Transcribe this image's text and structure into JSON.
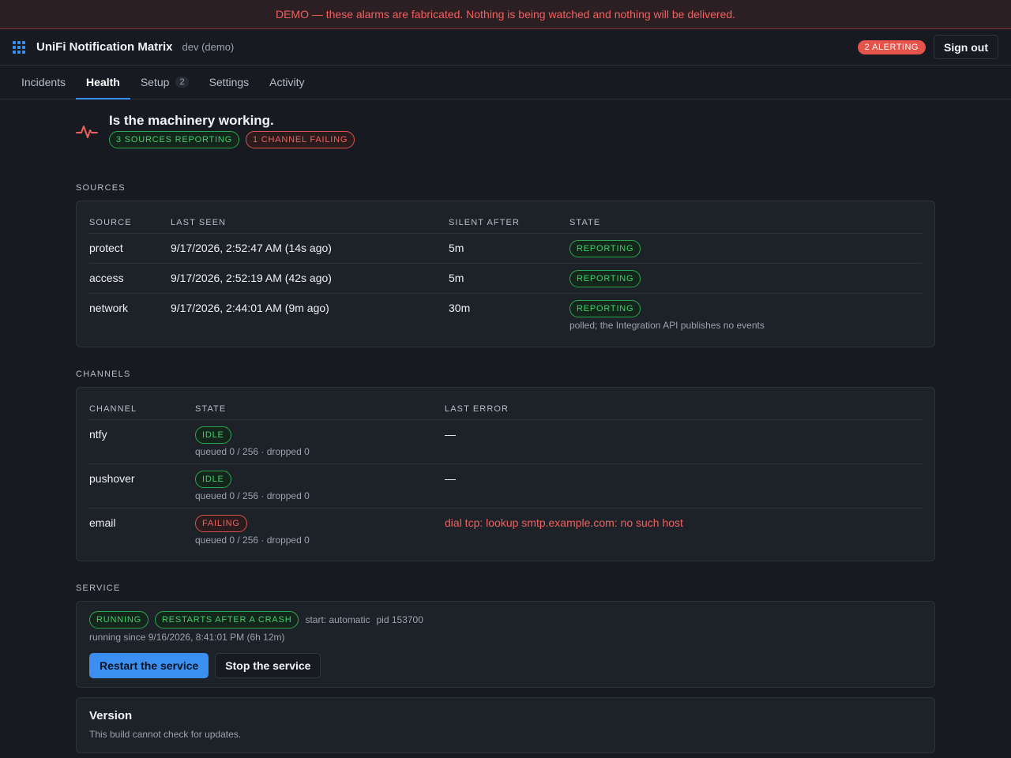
{
  "banner": {
    "text": "DEMO — these alarms are fabricated. Nothing is being watched and nothing will be delivered."
  },
  "app": {
    "title": "UniFi Notification Matrix",
    "env": "dev (demo)",
    "alert_badge": "2 ALERTING",
    "sign_out": "Sign out",
    "logo_icon": "grid-dots-icon"
  },
  "tabs": [
    {
      "label": "Incidents",
      "count": null
    },
    {
      "label": "Health",
      "count": null,
      "active": true
    },
    {
      "label": "Setup",
      "count": "2"
    },
    {
      "label": "Settings",
      "count": null
    },
    {
      "label": "Activity",
      "count": null
    }
  ],
  "health": {
    "title": "Is the machinery working.",
    "icon": "pulse-icon",
    "pill_sources": "3 sources reporting",
    "pill_channels": "1 channel failing"
  },
  "sources": {
    "label": "Sources",
    "headers": [
      "SOURCE",
      "LAST SEEN",
      "SILENT AFTER",
      "STATE"
    ],
    "rows": [
      {
        "source": "protect",
        "last_seen": "9/17/2026, 2:52:47 AM (14s ago)",
        "silent_after": "5m",
        "state": "REPORTING",
        "note": ""
      },
      {
        "source": "access",
        "last_seen": "9/17/2026, 2:52:19 AM (42s ago)",
        "silent_after": "5m",
        "state": "REPORTING",
        "note": ""
      },
      {
        "source": "network",
        "last_seen": "9/17/2026, 2:44:01 AM (9m ago)",
        "silent_after": "30m",
        "state": "REPORTING",
        "note": "polled; the Integration API publishes no events"
      }
    ]
  },
  "channels": {
    "label": "Channels",
    "headers": [
      "CHANNEL",
      "STATE",
      "LAST ERROR"
    ],
    "rows": [
      {
        "channel": "ntfy",
        "state": "IDLE",
        "queue": "queued 0 / 256 · dropped 0",
        "last_error": "—"
      },
      {
        "channel": "pushover",
        "state": "IDLE",
        "queue": "queued 0 / 256 · dropped 0",
        "last_error": "—"
      },
      {
        "channel": "email",
        "state": "FAILING",
        "queue": "queued 0 / 256 · dropped 0",
        "last_error": "dial tcp: lookup smtp.example.com: no such host"
      }
    ]
  },
  "service": {
    "label": "Service",
    "pill_running": "RUNNING",
    "pill_restart": "RESTARTS AFTER A CRASH",
    "start": "start: automatic",
    "pid": "pid 153700",
    "running_since": "running since 9/16/2026, 8:41:01 PM (6h 12m)",
    "restart_button": "Restart the service",
    "stop_button": "Stop the service"
  },
  "version": {
    "title": "Version",
    "note": "This build cannot check for updates."
  },
  "colors": {
    "accent": "#3b8ff0",
    "ok": "#3fcf6b",
    "error": "#f0605f",
    "alert_badge": "#e5534b"
  }
}
